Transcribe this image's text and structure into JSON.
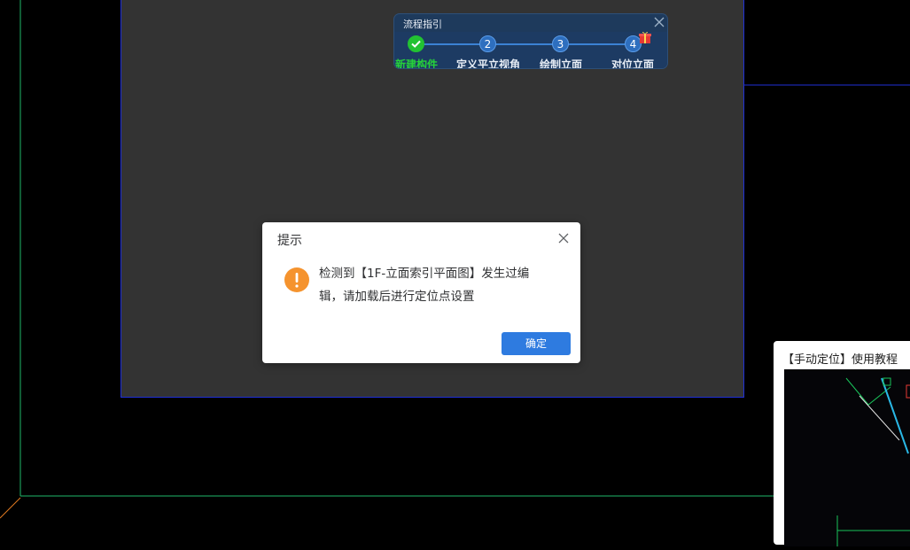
{
  "guide": {
    "title": "流程指引",
    "steps": [
      {
        "number": "",
        "label": "新建构件",
        "status": "done"
      },
      {
        "number": "2",
        "label": "定义平立视角",
        "status": "pending"
      },
      {
        "number": "3",
        "label": "绘制立面",
        "status": "pending"
      },
      {
        "number": "4",
        "label": "对位立面",
        "status": "pending"
      }
    ]
  },
  "dialog": {
    "title": "提示",
    "message": "检测到【1F-立面索引平面图】发生过编辑，请加载后进行定位点设置",
    "confirm_label": "确定",
    "icon": "warning-icon",
    "icon_color": "#f5932e"
  },
  "side_panel": {
    "title": "【手动定位】使用教程"
  },
  "colors": {
    "accent": "#2e7be0",
    "done_green": "#22c232",
    "viewport_border": "#1f2fd6"
  }
}
